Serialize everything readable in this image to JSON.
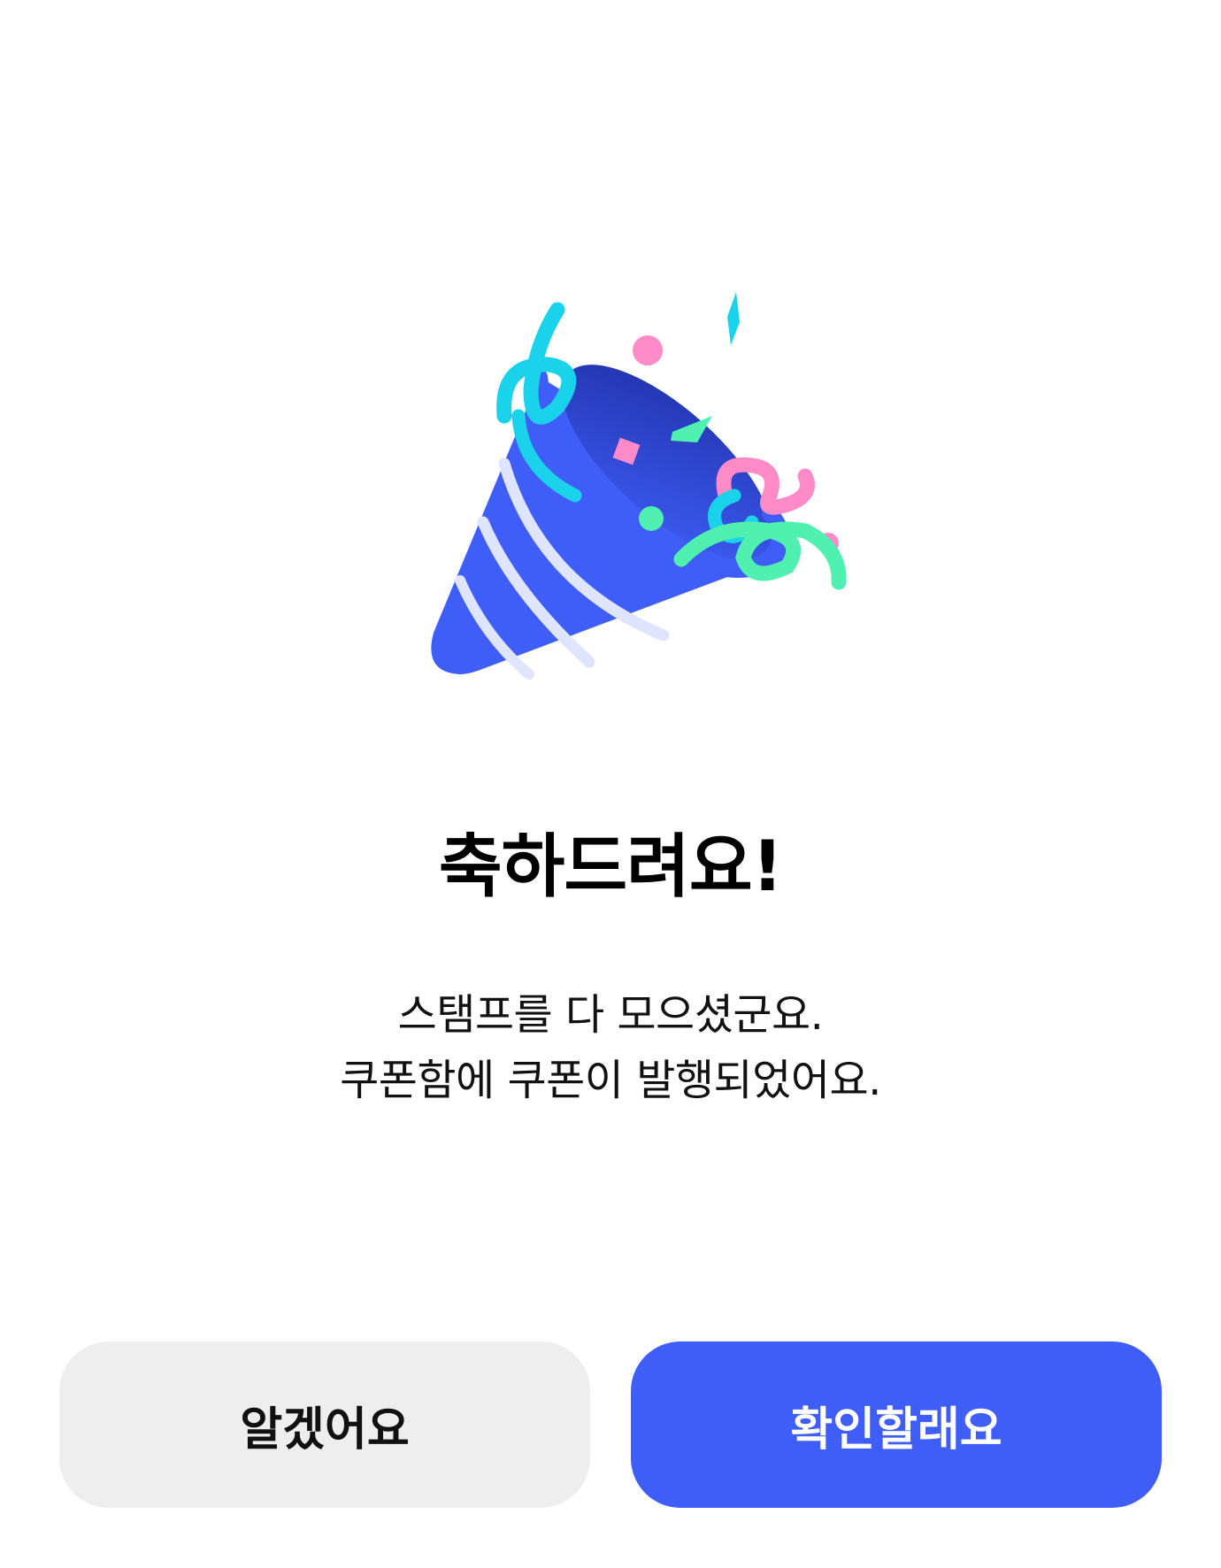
{
  "dialog": {
    "illustration_icon": "party-popper-icon",
    "title": "축하드려요!",
    "message_lines": [
      "스탬프를 다 모으셨군요.",
      "쿠폰함에 쿠폰이 발행되었어요."
    ],
    "buttons": {
      "secondary_label": "알겠어요",
      "primary_label": "확인할래요"
    }
  },
  "colors": {
    "primary": "#3f5ef8",
    "secondary_bg": "#eeeeee",
    "popper_blue": "#3f5ef8",
    "confetti_cyan": "#1ad3ea",
    "confetti_pink": "#ff8ac8",
    "confetti_green": "#4ff0b0"
  }
}
